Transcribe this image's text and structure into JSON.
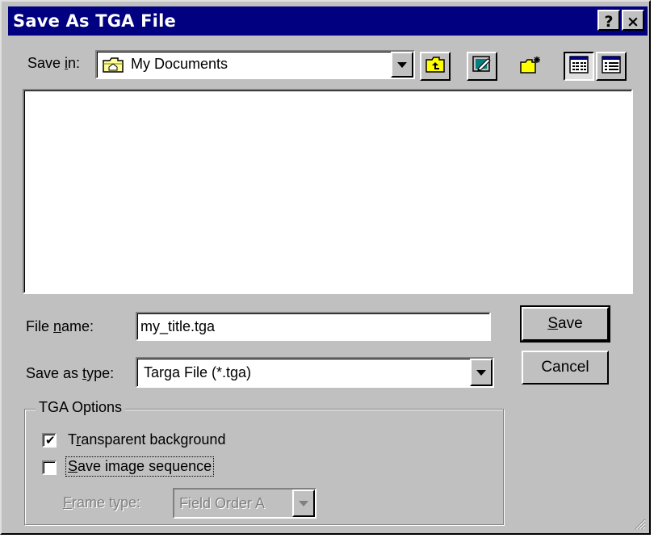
{
  "window": {
    "title": "Save As TGA File",
    "help_button": "?",
    "close_button": "×"
  },
  "save_in": {
    "label_pre": "Save ",
    "label_u": "i",
    "label_post": "n:",
    "value": "My Documents",
    "icon": "folder-icon"
  },
  "toolbar": {
    "up_one_level": "up-folder-icon",
    "desktop": "desktop-icon",
    "new_folder": "new-folder-icon",
    "list_view": "list-view-icon",
    "details_view": "details-view-icon"
  },
  "file_name": {
    "label_pre": "File ",
    "label_u": "n",
    "label_post": "ame:",
    "value": "my_title.tga"
  },
  "save_as_type": {
    "label_pre": "Save as ",
    "label_u": "t",
    "label_post": "ype:",
    "value": "Targa File (*.tga)"
  },
  "buttons": {
    "save_u": "S",
    "save_rest": "ave",
    "cancel": "Cancel"
  },
  "tga_options": {
    "title": "TGA Options",
    "transparent_pre": "T",
    "transparent_u": "r",
    "transparent_post": "ansparent background",
    "transparent_checked": true,
    "sequence_pre": "",
    "sequence_u": "S",
    "sequence_post": "ave image sequence",
    "sequence_checked": false,
    "frame_type_u": "F",
    "frame_type_post": "rame type:",
    "frame_type_value": "Field Order A"
  }
}
